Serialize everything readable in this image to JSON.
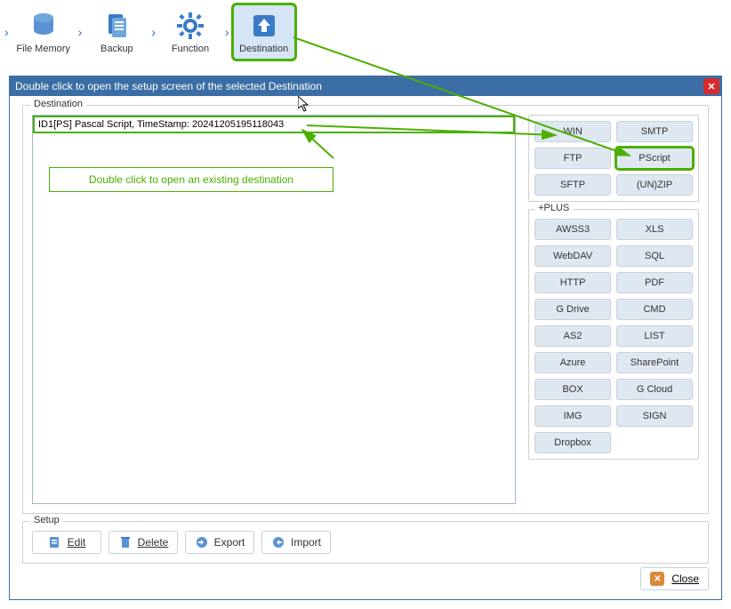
{
  "toolbar": {
    "items": [
      {
        "label": "File Memory"
      },
      {
        "label": "Backup"
      },
      {
        "label": "Function"
      },
      {
        "label": "Destination"
      }
    ]
  },
  "dialog": {
    "title": "Double click to open the setup screen of the selected Destination",
    "destination_legend": "Destination",
    "dest_item": "ID1[PS] Pascal Script, TimeStamp: 20241205195118043",
    "hint": "Double click to open an existing destination",
    "top_buttons": [
      "WIN",
      "SMTP",
      "FTP",
      "PScript",
      "SFTP",
      "(UN)ZIP"
    ],
    "plus_legend": "+PLUS",
    "plus_buttons": [
      "AWSS3",
      "XLS",
      "WebDAV",
      "SQL",
      "HTTP",
      "PDF",
      "G Drive",
      "CMD",
      "AS2",
      "LIST",
      "Azure",
      "SharePoint",
      "BOX",
      "G Cloud",
      "IMG",
      "SIGN",
      "Dropbox"
    ],
    "setup_legend": "Setup",
    "setup_buttons": {
      "edit": "Edit",
      "delete": "Delete",
      "export": "Export",
      "import": "Import"
    },
    "close": "Close"
  }
}
